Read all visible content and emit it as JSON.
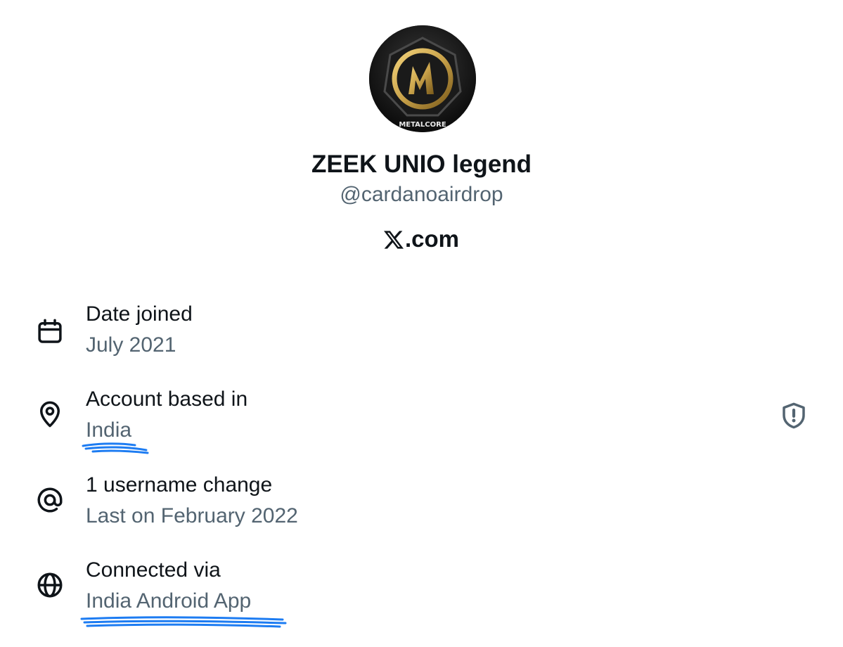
{
  "profile": {
    "avatar_icon": "metalcore-logo-avatar",
    "avatar_caption": "METALCORE",
    "display_name": "ZEEK UNIO legend",
    "handle": "@cardanoairdrop",
    "brand_suffix": ".com",
    "brand_icon": "x-logo-icon"
  },
  "rows": [
    {
      "icon": "calendar-icon",
      "label": "Date joined",
      "value": "July 2021"
    },
    {
      "icon": "location-pin-icon",
      "label": "Account based in",
      "value": "India"
    },
    {
      "icon": "at-sign-icon",
      "label": "1 username change",
      "value": "Last on February 2022"
    },
    {
      "icon": "globe-icon",
      "label": "Connected via",
      "value": "India Android App"
    }
  ],
  "side_icon": "shield-alert-icon",
  "colors": {
    "primary_text": "#0f1419",
    "secondary_text": "#536471",
    "highlight_scribble": "#1d7cf2",
    "avatar_gold": "#c9a24a"
  }
}
